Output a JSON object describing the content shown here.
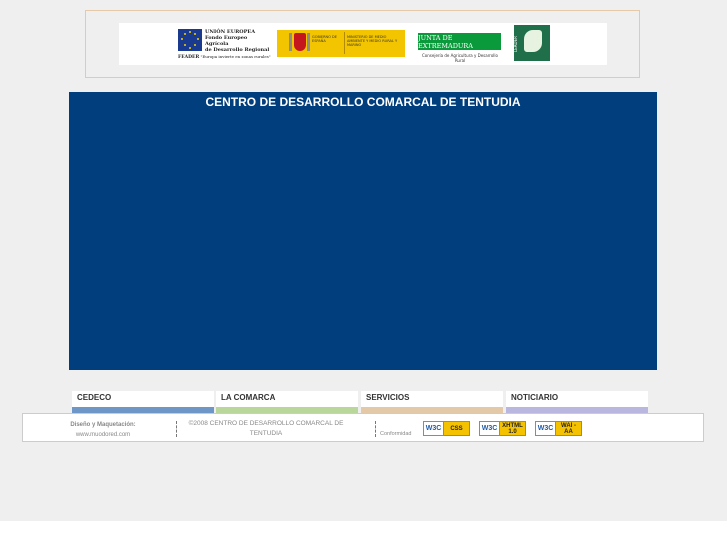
{
  "header": {
    "eu_logo": {
      "title_line1": "UNIÓN EUROPEA",
      "title_line2": "Fondo Europeo Agrícola",
      "title_line3": "de Desarrollo Regional",
      "feader": "FEADER",
      "tagline": "\"Europa invierte en zonas rurales\""
    },
    "gobierno_logo": {
      "left_text": "GOBIERNO DE ESPAÑA",
      "right_text": "MINISTERIO DE MEDIO AMBIENTE Y MEDIO RURAL Y MARINO"
    },
    "junta_logo": {
      "name": "JUNTA DE EXTREMADURA",
      "subtitle": "Consejería de Agricultura y Desarrollo Rural"
    },
    "leader_logo": {
      "text": "LEADER"
    }
  },
  "banner": {
    "title": "CENTRO DE DESARROLLO COMARCAL DE TENTUDIA",
    "color": "#003e7e"
  },
  "nav": {
    "items": [
      {
        "label": "CEDECO",
        "color": "#6e97c8"
      },
      {
        "label": "LA COMARCA",
        "color": "#b9d69b"
      },
      {
        "label": "SERVICIOS",
        "color": "#e4c9a8"
      },
      {
        "label": "NOTICIARIO",
        "color": "#b9b6e0"
      }
    ]
  },
  "footer": {
    "design_label": "Diseño y Maquetación:",
    "design_url": "www.muodored.com",
    "copyright_line1": "©2008 CENTRO DE DESARROLLO COMARCAL DE",
    "copyright_line2": "TENTUDIA",
    "conformity_label": "Conformidad",
    "badges": [
      {
        "w3c": "W3C",
        "text": "CSS"
      },
      {
        "w3c": "W3C",
        "text": "XHTML 1.0"
      },
      {
        "w3c": "W3C",
        "text": "WAI - AA"
      }
    ]
  }
}
